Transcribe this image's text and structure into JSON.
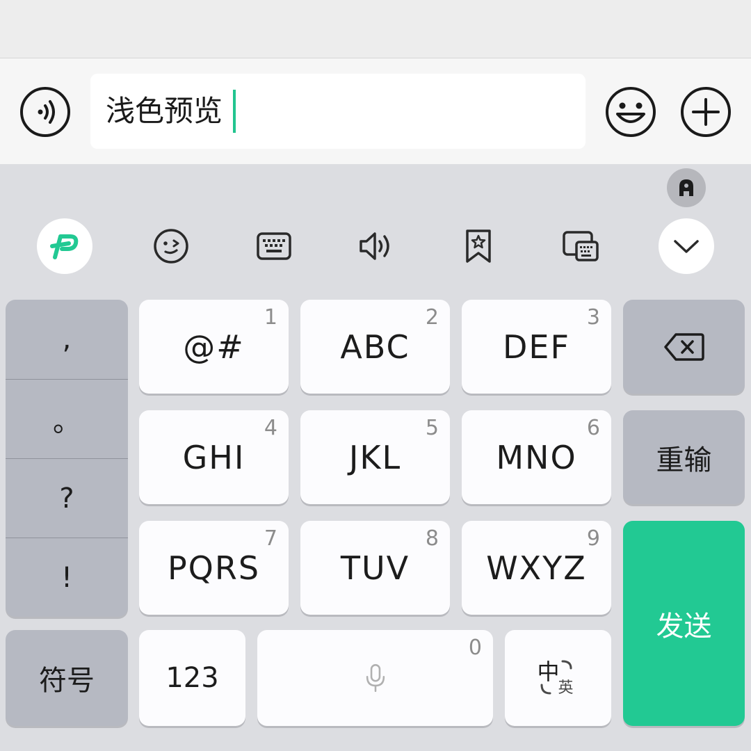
{
  "input": {
    "value": "浅色预览"
  },
  "icons": {
    "voice_input": "voice-wave-icon",
    "emoji": "smiley-face-icon",
    "add": "plus-circle-icon",
    "float_badge": "accessibility-a-icon",
    "logo": "ime-logo-icon",
    "sticker": "wink-face-icon",
    "keyboard_layout": "keyboard-icon",
    "sound": "speaker-icon",
    "favorites": "bookmark-star-icon",
    "float_keyboard": "floating-keyboard-icon",
    "collapse": "chevron-down-icon",
    "backspace": "backspace-icon",
    "mic": "microphone-icon",
    "lang_switch": "zh-en-switch-icon"
  },
  "punctuation": [
    ",",
    "。",
    "?",
    "!"
  ],
  "keys": {
    "row1": [
      {
        "label": "@#",
        "num": "1"
      },
      {
        "label": "ABC",
        "num": "2"
      },
      {
        "label": "DEF",
        "num": "3"
      }
    ],
    "row2": [
      {
        "label": "GHI",
        "num": "4"
      },
      {
        "label": "JKL",
        "num": "5"
      },
      {
        "label": "MNO",
        "num": "6"
      }
    ],
    "row3": [
      {
        "label": "PQRS",
        "num": "7"
      },
      {
        "label": "TUV",
        "num": "8"
      },
      {
        "label": "WXYZ",
        "num": "9"
      }
    ],
    "reinput": "重输",
    "send": "发送",
    "symbols": "符号",
    "numeric": "123",
    "space_num": "0",
    "lang_zh": "中",
    "lang_en": "英"
  },
  "colors": {
    "accent": "#22c993",
    "caret": "#22c48f",
    "logo": "#22c993"
  }
}
